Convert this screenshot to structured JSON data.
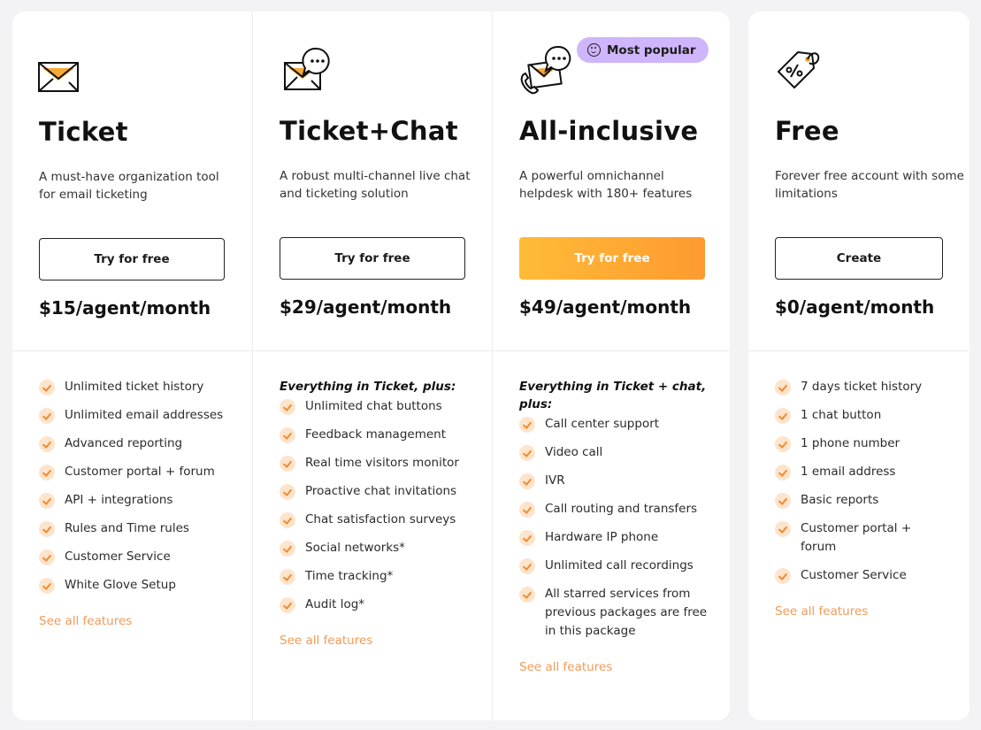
{
  "colors": {
    "page_bg": "#f3f3f5",
    "accent_orange": "#ff9a30",
    "accent_yellow": "#ffbb38",
    "badge_purple": "#cfb5fb",
    "link_orange": "#f29a55",
    "check_bg": "#fde4cc"
  },
  "plans": [
    {
      "icon": "envelope-icon",
      "title": "Ticket",
      "description": "A must-have organization tool for email ticketing",
      "cta_label": "Try for free",
      "price": "$15/agent/month",
      "plus_label": "",
      "features": [
        "Unlimited ticket history",
        "Unlimited email addresses",
        "Advanced reporting",
        "Customer portal + forum",
        "API + integrations",
        "Rules and Time rules",
        "Customer Service",
        "White Glove Setup"
      ],
      "see_all_label": "See all features"
    },
    {
      "icon": "envelope-chat-icon",
      "title": "Ticket+Chat",
      "description": "A robust multi-channel live chat and ticketing solution",
      "cta_label": "Try for free",
      "price": "$29/agent/month",
      "plus_label": "Everything in Ticket, plus:",
      "features": [
        "Unlimited chat buttons",
        "Feedback management",
        "Real time visitors monitor",
        "Proactive chat invitations",
        "Chat satisfaction surveys",
        "Social networks*",
        "Time tracking*",
        "Audit log*"
      ],
      "see_all_label": "See all features"
    },
    {
      "icon": "phone-envelope-chat-icon",
      "badge": "Most popular",
      "title": "All-inclusive",
      "description": "A powerful omnichannel helpdesk with 180+ features",
      "cta_label": "Try for free",
      "price": "$49/agent/month",
      "plus_label": "Everything in Ticket + chat, plus:",
      "features": [
        "Call center support",
        "Video call",
        "IVR",
        "Call routing and transfers",
        "Hardware IP phone",
        "Unlimited call recordings",
        "All starred services from previous packages are free in this package"
      ],
      "see_all_label": "See all features"
    },
    {
      "icon": "price-tag-icon",
      "title": "Free",
      "description": "Forever free account with some limitations",
      "cta_label": "Create",
      "price": "$0/agent/month",
      "plus_label": "",
      "features": [
        "7 days ticket history",
        "1 chat button",
        "1 phone number",
        "1 email address",
        "Basic reports",
        "Customer portal + forum",
        "Customer Service"
      ],
      "see_all_label": "See all features"
    }
  ]
}
